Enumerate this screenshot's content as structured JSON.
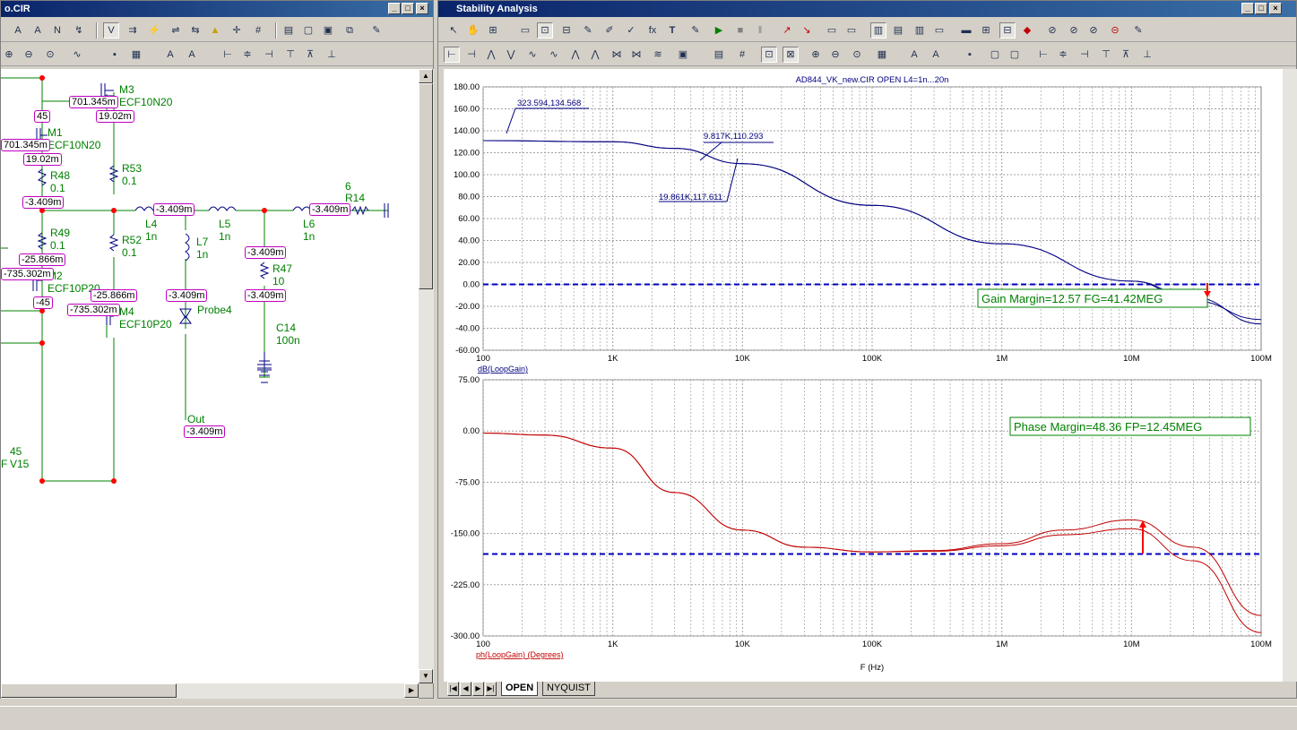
{
  "schematic": {
    "title": "o.CIR",
    "components": [
      {
        "name": "M3",
        "model": "ECF10N20"
      },
      {
        "name": "M1",
        "model": "ECF10N20"
      },
      {
        "name": "M2",
        "model": "ECF10P20"
      },
      {
        "name": "M4",
        "model": "ECF10P20"
      },
      {
        "name": "R53",
        "value": "0.1"
      },
      {
        "name": "R48",
        "value": "0.1"
      },
      {
        "name": "R49",
        "value": "0.1"
      },
      {
        "name": "R52",
        "value": "0.1"
      },
      {
        "name": "R47",
        "value": "10"
      },
      {
        "name": "R14",
        "value": ""
      },
      {
        "name": "L4",
        "value": "1n"
      },
      {
        "name": "L5",
        "value": "1n"
      },
      {
        "name": "L6",
        "value": "1n"
      },
      {
        "name": "L7",
        "value": "1n"
      },
      {
        "name": "C14",
        "value": "100n"
      }
    ],
    "labels": {
      "probe": "Probe4",
      "out": "Out",
      "v15": "V15",
      "n45": "45",
      "n6": "6",
      "f": "F"
    },
    "node_values": [
      "701.345m",
      "19.02m",
      "45",
      "701.345m",
      "19.02m",
      "-3.409m",
      "-3.409m",
      "-3.409m",
      "-3.409m",
      "-3.409m",
      "-3.409m",
      "-25.866m",
      "-735.302m",
      "-45",
      "-25.866m",
      "-735.302m",
      "-3.409m"
    ]
  },
  "analysis": {
    "title": "Stability Analysis",
    "tabs": [
      "OPEN",
      "NYQUIST"
    ],
    "active_tab": "OPEN"
  },
  "chart_data": [
    {
      "type": "line",
      "title": "AD844_VK_new.CIR OPEN L4=1n...20n",
      "ylabel": "dB(LoopGain)",
      "x_scale": "log",
      "xlim": [
        100,
        100000000
      ],
      "ylim": [
        -60,
        180
      ],
      "y_ticks": [
        "180.00",
        "160.00",
        "140.00",
        "120.00",
        "100.00",
        "80.00",
        "60.00",
        "40.00",
        "20.00",
        "0.00",
        "-20.00",
        "-40.00",
        "-60.00"
      ],
      "x_ticks": [
        "100",
        "1K",
        "10K",
        "100K",
        "1M",
        "10M",
        "100M"
      ],
      "color": "#000080",
      "series": [
        {
          "x": [
            100,
            1000,
            3000,
            10000,
            100000,
            1000000,
            10000000,
            30000000,
            100000000
          ],
          "y": [
            131,
            130,
            124,
            110,
            72,
            37,
            3,
            -15,
            -32
          ]
        },
        {
          "x": [
            100,
            1000,
            3000,
            10000,
            100000,
            1000000,
            10000000,
            30000000,
            100000000
          ],
          "y": [
            131,
            130,
            124,
            110,
            72,
            37,
            3,
            -12,
            -36
          ]
        }
      ],
      "reference_line": 0,
      "annotations": [
        "323.594,134.568",
        "9.817K,110.293",
        "19.861K,117.611",
        "Gain Margin=12.57 FG=41.42MEG"
      ]
    },
    {
      "type": "line",
      "xlabel": "F (Hz)",
      "ylabel": "ph(LoopGain) (Degrees)",
      "x_scale": "log",
      "xlim": [
        100,
        100000000
      ],
      "ylim": [
        -300,
        75
      ],
      "y_ticks": [
        "75.00",
        "0.00",
        "-75.00",
        "-150.00",
        "-225.00",
        "-300.00"
      ],
      "x_ticks": [
        "100",
        "1K",
        "10K",
        "100K",
        "1M",
        "10M",
        "100M"
      ],
      "color": "#c00000",
      "series": [
        {
          "x": [
            100,
            300,
            1000,
            3000,
            10000,
            30000,
            100000,
            300000,
            1000000,
            3000000,
            10000000,
            30000000,
            100000000
          ],
          "y": [
            -3,
            -6,
            -25,
            -90,
            -145,
            -170,
            -177,
            -175,
            -165,
            -145,
            -130,
            -170,
            -270
          ]
        },
        {
          "x": [
            100,
            300,
            1000,
            3000,
            10000,
            30000,
            100000,
            300000,
            1000000,
            3000000,
            10000000,
            30000000,
            100000000
          ],
          "y": [
            -3,
            -6,
            -25,
            -90,
            -145,
            -170,
            -177,
            -176,
            -168,
            -152,
            -143,
            -190,
            -295
          ]
        }
      ],
      "reference_line": -180,
      "annotations": [
        "Phase Margin=48.36 FP=12.45MEG"
      ]
    }
  ]
}
